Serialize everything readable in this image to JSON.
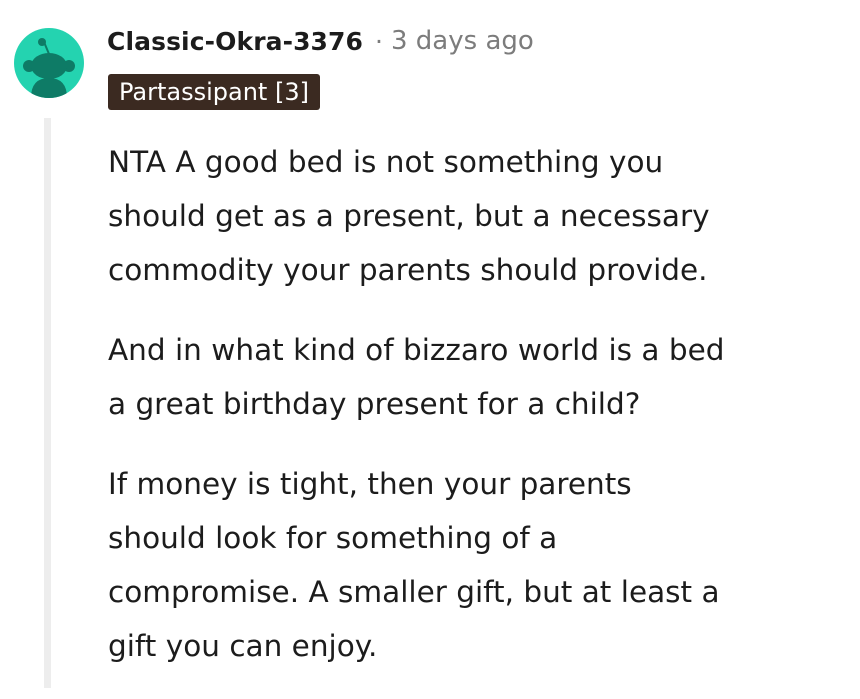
{
  "comment": {
    "author": "Classic-Okra-3376",
    "separator": "·",
    "time_ago": "3 days ago",
    "flair": "Partassipant [3]",
    "avatar_icon": "snoo-avatar-icon",
    "colors": {
      "avatar_bg": "#24d3b0",
      "flair_bg": "#3b2a21",
      "thread_line": "#ededed",
      "muted_text": "#7c7c7c"
    },
    "paragraphs": [
      {
        "lines": [
          "NTA A good bed is not something you",
          "should get as a present,  but a necessary",
          "commodity your parents should provide."
        ]
      },
      {
        "lines": [
          "And in what kind of bizzaro world is a bed",
          "a great birthday present for a child?"
        ]
      },
      {
        "lines": [
          "If money is tight, then your parents",
          "should look for something of a",
          "compromise. A smaller gift, but at least a",
          "gift you can enjoy."
        ]
      }
    ]
  }
}
